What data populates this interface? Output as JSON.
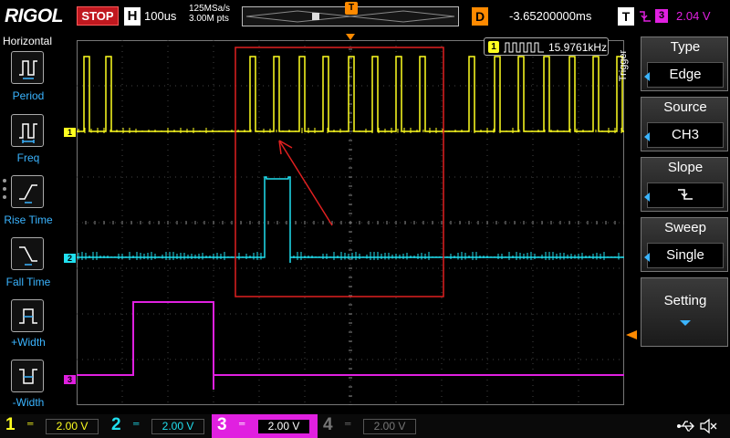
{
  "topbar": {
    "brand": "RIGOL",
    "status": "STOP",
    "timebase_badge": "H",
    "timebase": "100us",
    "sample_rate": "125MSa/s",
    "memory_depth": "3.00M pts",
    "trigger_pos_marker": "T",
    "delay_badge": "D",
    "delay": "-3.65200000ms",
    "trigger_badge": "T",
    "trigger_source_badge": "3",
    "trigger_level": "2.04 V"
  },
  "left_panel": {
    "title": "Horizontal",
    "items": [
      {
        "label": "Period"
      },
      {
        "label": "Freq"
      },
      {
        "label": "Rise Time"
      },
      {
        "label": "Fall Time"
      },
      {
        "label": "+Width"
      },
      {
        "label": "-Width"
      }
    ]
  },
  "measurement": {
    "channel": "1",
    "frequency": "15.9761kHz"
  },
  "channel_markers": [
    "1",
    "2",
    "3"
  ],
  "trigger_menu": {
    "tab_label": "Trigger",
    "items": [
      {
        "title": "Type",
        "value": "Edge"
      },
      {
        "title": "Source",
        "value": "CH3"
      },
      {
        "title": "Slope",
        "value": ""
      },
      {
        "title": "Sweep",
        "value": "Single"
      },
      {
        "title": "Setting"
      }
    ]
  },
  "channels": [
    {
      "num": "1",
      "scale": "2.00 V",
      "color": "#ffff20"
    },
    {
      "num": "2",
      "scale": "2.00 V",
      "color": "#20e0f0"
    },
    {
      "num": "3",
      "scale": "2.00 V",
      "color": "#e020e0"
    },
    {
      "num": "4",
      "scale": "2.00 V",
      "color": "#666666"
    }
  ],
  "colors": {
    "ch1": "#ffff20",
    "ch2": "#20e0f0",
    "ch3": "#e020e0",
    "trigger": "#ff8a00",
    "annotation": "#e02020",
    "accent": "#3ab4ff"
  },
  "icons": {
    "usb": "usb-icon",
    "speaker": "speaker-mute-icon"
  }
}
